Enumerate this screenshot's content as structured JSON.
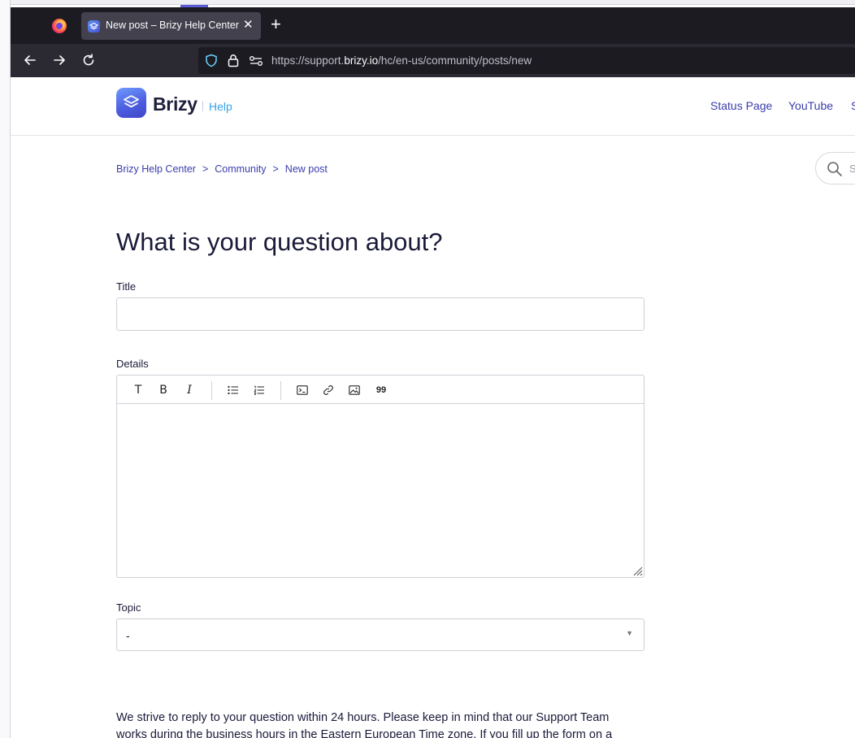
{
  "browser": {
    "tab_title": "New post – Brizy Help Center",
    "url_prefix": "https://support.",
    "url_host": "brizy.io",
    "url_path": "/hc/en-us/community/posts/new"
  },
  "header": {
    "brand": "Brizy",
    "brand_sub": "Help",
    "links": [
      "Status Page",
      "YouTube",
      "S"
    ]
  },
  "breadcrumb": [
    "Brizy Help Center",
    "Community",
    "New post"
  ],
  "search": {
    "placeholder": "S"
  },
  "form": {
    "heading": "What is your question about?",
    "title_label": "Title",
    "title_value": "",
    "details_label": "Details",
    "toolbar": [
      "T",
      "B",
      "I",
      "bulleted-list",
      "numbered-list",
      "code",
      "link",
      "image",
      "quote"
    ],
    "quote_glyph": "99",
    "topic_label": "Topic",
    "topic_value": "-"
  },
  "info": "We strive to reply to your question within 24 hours. Please keep in mind that our Support Team works during the business hours in the Eastern European Time zone. If you fill up the form on a",
  "colors": {
    "link": "#3a3dad",
    "brand_help": "#3aa2e8",
    "tabstrip": "#1c1b22"
  }
}
